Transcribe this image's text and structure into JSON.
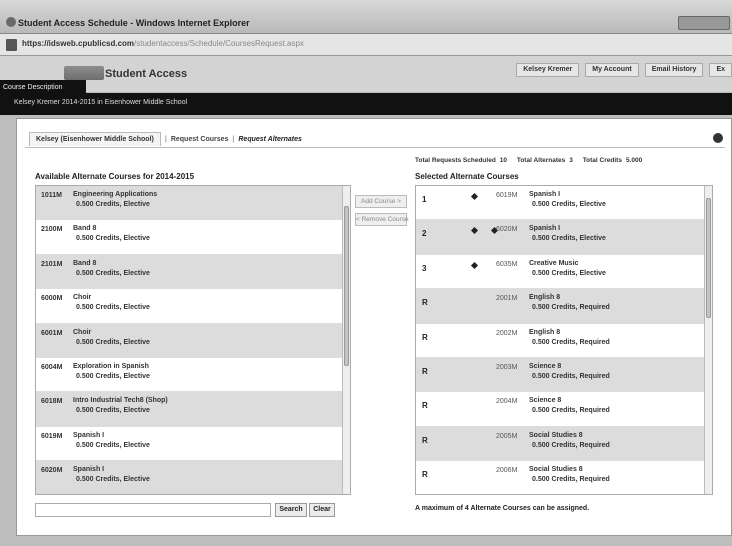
{
  "browser": {
    "window_title": "Student Access Schedule - Windows Internet Explorer",
    "url_prefix": "https://",
    "url_bold": "idsweb.cpublicsd.com",
    "url_rest": "/studentaccess/Schedule/CoursesRequest.aspx"
  },
  "app": {
    "title": "Student Access",
    "top_links": [
      "Kelsey Kremer",
      "My Account",
      "Email History",
      "Ex"
    ],
    "tooltip": "Course Description",
    "context_bar": "Kelsey Kremer 2014-2015 in Eisenhower Middle School"
  },
  "tabs": {
    "active": "Kelsey (Eisenhower Middle School)",
    "second": "Request Courses",
    "third": "Request Alternates"
  },
  "totals": {
    "requests_label": "Total Requests Scheduled",
    "requests_value": "10",
    "alternates_label": "Total Alternates",
    "alternates_value": "3",
    "credits_label": "Total Credits",
    "credits_value": "5.000"
  },
  "available": {
    "title": "Available Alternate Courses for 2014-2015",
    "items": [
      {
        "code": "1011M",
        "name": "Engineering Applications",
        "meta": "0.500 Credits, Elective"
      },
      {
        "code": "2100M",
        "name": "Band 8",
        "meta": "0.500 Credits, Elective"
      },
      {
        "code": "2101M",
        "name": "Band 8",
        "meta": "0.500 Credits, Elective"
      },
      {
        "code": "6000M",
        "name": "Choir",
        "meta": "0.500 Credits, Elective"
      },
      {
        "code": "6001M",
        "name": "Choir",
        "meta": "0.500 Credits, Elective"
      },
      {
        "code": "6004M",
        "name": "Exploration in Spanish",
        "meta": "0.500 Credits, Elective"
      },
      {
        "code": "6018M",
        "name": "Intro Industrial Tech8 (Shop)",
        "meta": "0.500 Credits, Elective"
      },
      {
        "code": "6019M",
        "name": "Spanish I",
        "meta": "0.500 Credits, Elective"
      },
      {
        "code": "6020M",
        "name": "Spanish I",
        "meta": "0.500 Credits, Elective"
      }
    ]
  },
  "buttons": {
    "add": "Add Course >",
    "remove": "< Remove Course",
    "search": "Search",
    "clear": "Clear"
  },
  "selected": {
    "title": "Selected Alternate Courses",
    "items": [
      {
        "priority": "1",
        "dots": 1,
        "code": "6019M",
        "name": "Spanish I",
        "meta": "0.500 Credits, Elective"
      },
      {
        "priority": "2",
        "dots": 2,
        "code": "6020M",
        "name": "Spanish I",
        "meta": "0.500 Credits, Elective"
      },
      {
        "priority": "3",
        "dots": 1,
        "code": "6035M",
        "name": "Creative Music",
        "meta": "0.500 Credits, Elective"
      },
      {
        "priority": "R",
        "dots": 0,
        "code": "2001M",
        "name": "English 8",
        "meta": "0.500 Credits, Required"
      },
      {
        "priority": "R",
        "dots": 0,
        "code": "2002M",
        "name": "English 8",
        "meta": "0.500 Credits, Required"
      },
      {
        "priority": "R",
        "dots": 0,
        "code": "2003M",
        "name": "Science 8",
        "meta": "0.500 Credits, Required"
      },
      {
        "priority": "R",
        "dots": 0,
        "code": "2004M",
        "name": "Science 8",
        "meta": "0.500 Credits, Required"
      },
      {
        "priority": "R",
        "dots": 0,
        "code": "2005M",
        "name": "Social Studies 8",
        "meta": "0.500 Credits, Required"
      },
      {
        "priority": "R",
        "dots": 0,
        "code": "2006M",
        "name": "Social Studies 8",
        "meta": "0.500 Credits, Required"
      }
    ]
  },
  "footer_note": "A maximum of 4 Alternate Courses can be assigned."
}
